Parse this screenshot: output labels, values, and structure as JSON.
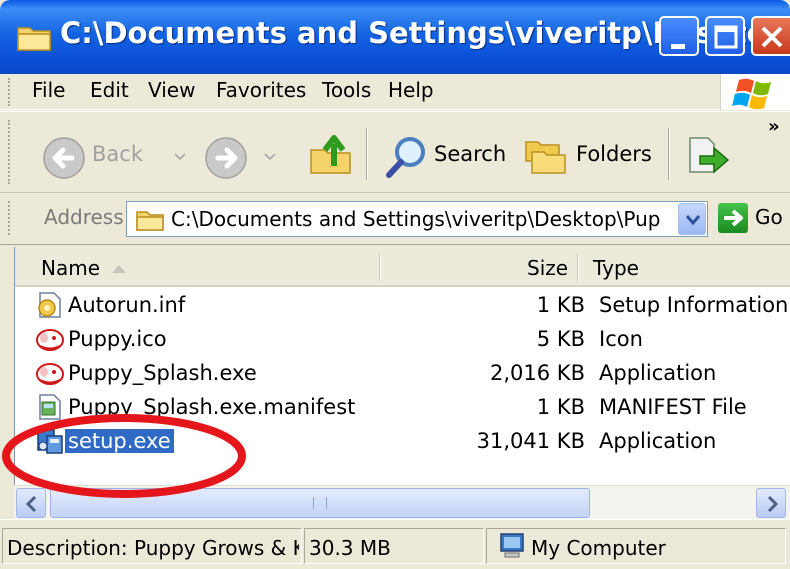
{
  "window": {
    "title": "C:\\Documents and Settings\\viveritp\\Desktop\\..."
  },
  "menu": {
    "items": [
      {
        "label": "File"
      },
      {
        "label": "Edit"
      },
      {
        "label": "View"
      },
      {
        "label": "Favorites"
      },
      {
        "label": "Tools"
      },
      {
        "label": "Help"
      }
    ]
  },
  "toolbar": {
    "back_label": "Back",
    "search_label": "Search",
    "folders_label": "Folders",
    "overflow_label": "»"
  },
  "address": {
    "label": "Address",
    "value": "C:\\Documents and Settings\\viveritp\\Desktop\\Pup",
    "go_label": "Go"
  },
  "columns": {
    "name": "Name",
    "size": "Size",
    "type": "Type"
  },
  "files": [
    {
      "name": "Autorun.inf",
      "size": "1 KB",
      "type": "Setup Information",
      "icon": "inf-file-icon"
    },
    {
      "name": "Puppy.ico",
      "size": "5 KB",
      "type": "Icon",
      "icon": "puppy-icon"
    },
    {
      "name": "Puppy_Splash.exe",
      "size": "2,016 KB",
      "type": "Application",
      "icon": "puppy-icon"
    },
    {
      "name": "Puppy_Splash.exe.manifest",
      "size": "1 KB",
      "type": "MANIFEST File",
      "icon": "manifest-file-icon"
    },
    {
      "name": "setup.exe",
      "size": "31,041 KB",
      "type": "Application",
      "icon": "setup-icon",
      "selected": true
    }
  ],
  "status": {
    "description": "Description: Puppy Grows & Knc",
    "size": "30.3 MB",
    "location": "My Computer"
  },
  "colors": {
    "titlebar": "#0b4fd8",
    "selection": "#316ac5",
    "annotation": "#e4161c"
  }
}
